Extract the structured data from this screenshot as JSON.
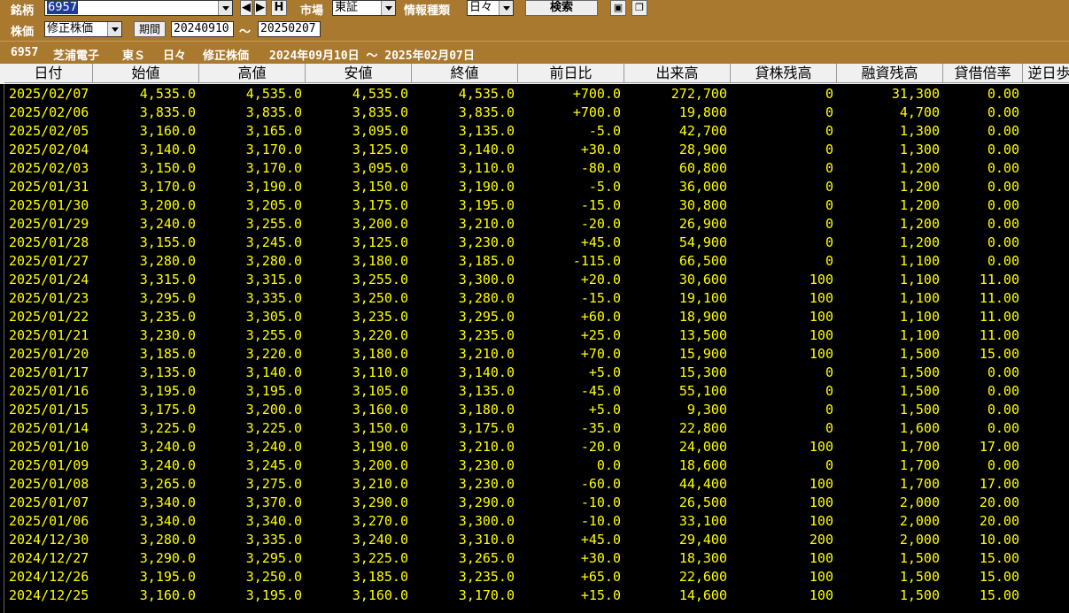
{
  "toolbar": {
    "symbol_label": "銘柄",
    "symbol_value": "6957",
    "h_button": "H",
    "market_label": "市場",
    "market_value": "東証",
    "info_type_label": "情報種類",
    "info_type_value": "日々",
    "search_button": "検索",
    "price_label": "株価",
    "price_value": "修正株価",
    "period_button": "期間",
    "period_from": "20240910",
    "period_tilde": "〜",
    "period_to": "20250207"
  },
  "info": {
    "code": "6957",
    "name": "芝浦電子",
    "market": "東Ｓ",
    "type": "日々",
    "price_type": "修正株価",
    "range": "2024年09月10日 〜 2025年02月07日"
  },
  "columns": [
    "日付",
    "始値",
    "高値",
    "安値",
    "終値",
    "前日比",
    "出来高",
    "貸株残高",
    "融資残高",
    "貸借倍率",
    "逆日歩"
  ],
  "rows": [
    [
      "2025/02/07",
      "4,535.0",
      "4,535.0",
      "4,535.0",
      "4,535.0",
      "+700.0",
      "272,700",
      "0",
      "31,300",
      "0.00"
    ],
    [
      "2025/02/06",
      "3,835.0",
      "3,835.0",
      "3,835.0",
      "3,835.0",
      "+700.0",
      "19,800",
      "0",
      "4,700",
      "0.00"
    ],
    [
      "2025/02/05",
      "3,160.0",
      "3,165.0",
      "3,095.0",
      "3,135.0",
      "-5.0",
      "42,700",
      "0",
      "1,300",
      "0.00"
    ],
    [
      "2025/02/04",
      "3,140.0",
      "3,170.0",
      "3,125.0",
      "3,140.0",
      "+30.0",
      "28,900",
      "0",
      "1,300",
      "0.00"
    ],
    [
      "2025/02/03",
      "3,150.0",
      "3,170.0",
      "3,095.0",
      "3,110.0",
      "-80.0",
      "60,800",
      "0",
      "1,200",
      "0.00"
    ],
    [
      "2025/01/31",
      "3,170.0",
      "3,190.0",
      "3,150.0",
      "3,190.0",
      "-5.0",
      "36,000",
      "0",
      "1,200",
      "0.00"
    ],
    [
      "2025/01/30",
      "3,200.0",
      "3,205.0",
      "3,175.0",
      "3,195.0",
      "-15.0",
      "30,800",
      "0",
      "1,200",
      "0.00"
    ],
    [
      "2025/01/29",
      "3,240.0",
      "3,255.0",
      "3,200.0",
      "3,210.0",
      "-20.0",
      "26,900",
      "0",
      "1,200",
      "0.00"
    ],
    [
      "2025/01/28",
      "3,155.0",
      "3,245.0",
      "3,125.0",
      "3,230.0",
      "+45.0",
      "54,900",
      "0",
      "1,200",
      "0.00"
    ],
    [
      "2025/01/27",
      "3,280.0",
      "3,280.0",
      "3,180.0",
      "3,185.0",
      "-115.0",
      "66,500",
      "0",
      "1,100",
      "0.00"
    ],
    [
      "2025/01/24",
      "3,315.0",
      "3,315.0",
      "3,255.0",
      "3,300.0",
      "+20.0",
      "30,600",
      "100",
      "1,100",
      "11.00"
    ],
    [
      "2025/01/23",
      "3,295.0",
      "3,335.0",
      "3,250.0",
      "3,280.0",
      "-15.0",
      "19,100",
      "100",
      "1,100",
      "11.00"
    ],
    [
      "2025/01/22",
      "3,235.0",
      "3,305.0",
      "3,235.0",
      "3,295.0",
      "+60.0",
      "18,900",
      "100",
      "1,100",
      "11.00"
    ],
    [
      "2025/01/21",
      "3,230.0",
      "3,255.0",
      "3,220.0",
      "3,235.0",
      "+25.0",
      "13,500",
      "100",
      "1,100",
      "11.00"
    ],
    [
      "2025/01/20",
      "3,185.0",
      "3,220.0",
      "3,180.0",
      "3,210.0",
      "+70.0",
      "15,900",
      "100",
      "1,500",
      "15.00"
    ],
    [
      "2025/01/17",
      "3,135.0",
      "3,140.0",
      "3,110.0",
      "3,140.0",
      "+5.0",
      "15,300",
      "0",
      "1,500",
      "0.00"
    ],
    [
      "2025/01/16",
      "3,195.0",
      "3,195.0",
      "3,105.0",
      "3,135.0",
      "-45.0",
      "55,100",
      "0",
      "1,500",
      "0.00"
    ],
    [
      "2025/01/15",
      "3,175.0",
      "3,200.0",
      "3,160.0",
      "3,180.0",
      "+5.0",
      "9,300",
      "0",
      "1,500",
      "0.00"
    ],
    [
      "2025/01/14",
      "3,225.0",
      "3,225.0",
      "3,150.0",
      "3,175.0",
      "-35.0",
      "22,800",
      "0",
      "1,600",
      "0.00"
    ],
    [
      "2025/01/10",
      "3,240.0",
      "3,240.0",
      "3,190.0",
      "3,210.0",
      "-20.0",
      "24,000",
      "100",
      "1,700",
      "17.00"
    ],
    [
      "2025/01/09",
      "3,240.0",
      "3,245.0",
      "3,200.0",
      "3,230.0",
      "0.0",
      "18,600",
      "0",
      "1,700",
      "0.00"
    ],
    [
      "2025/01/08",
      "3,265.0",
      "3,275.0",
      "3,210.0",
      "3,230.0",
      "-60.0",
      "44,400",
      "100",
      "1,700",
      "17.00"
    ],
    [
      "2025/01/07",
      "3,340.0",
      "3,370.0",
      "3,290.0",
      "3,290.0",
      "-10.0",
      "26,500",
      "100",
      "2,000",
      "20.00"
    ],
    [
      "2025/01/06",
      "3,340.0",
      "3,340.0",
      "3,270.0",
      "3,300.0",
      "-10.0",
      "33,100",
      "100",
      "2,000",
      "20.00"
    ],
    [
      "2024/12/30",
      "3,280.0",
      "3,335.0",
      "3,240.0",
      "3,310.0",
      "+45.0",
      "29,400",
      "200",
      "2,000",
      "10.00"
    ],
    [
      "2024/12/27",
      "3,290.0",
      "3,295.0",
      "3,225.0",
      "3,265.0",
      "+30.0",
      "18,300",
      "100",
      "1,500",
      "15.00"
    ],
    [
      "2024/12/26",
      "3,195.0",
      "3,250.0",
      "3,185.0",
      "3,235.0",
      "+65.0",
      "22,600",
      "100",
      "1,500",
      "15.00"
    ],
    [
      "2024/12/25",
      "3,160.0",
      "3,195.0",
      "3,160.0",
      "3,170.0",
      "+15.0",
      "14,600",
      "100",
      "1,500",
      "15.00"
    ]
  ]
}
